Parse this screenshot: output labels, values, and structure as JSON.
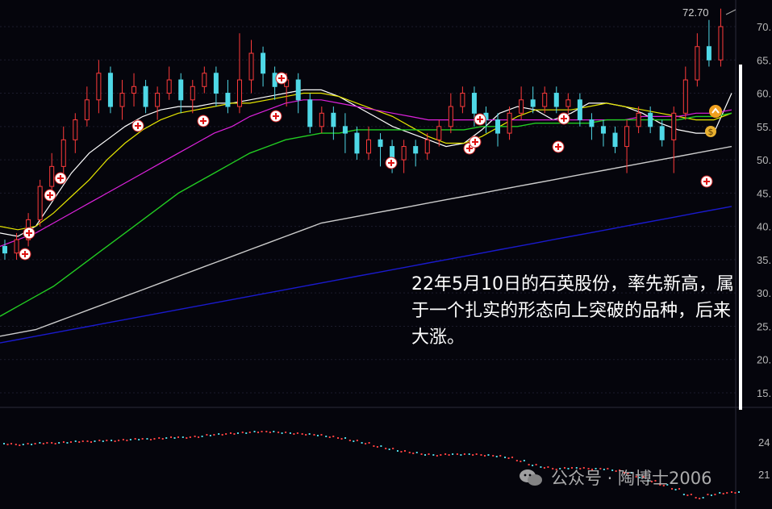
{
  "chart_data": {
    "type": "candlestick",
    "price_axis": {
      "ticks": [
        "70.",
        "65.",
        "60.",
        "55.",
        "50.",
        "45.",
        "40.",
        "35.",
        "30.",
        "25.",
        "20.",
        "15."
      ],
      "range": [
        12,
        75
      ]
    },
    "indicator_axis": {
      "ticks": [
        "24",
        "21"
      ]
    },
    "high_marker": "72.70",
    "annotation": "22年5月10日的石英股份，率先新高，属于一个扎实的形态向上突破的品种，后来大涨。",
    "moving_averages": [
      {
        "color": "#ffffff",
        "values": [
          39,
          38.5,
          40,
          44,
          48,
          51,
          53,
          55,
          56.5,
          57.5,
          58,
          58,
          58.5,
          58.5,
          59,
          59.5,
          60,
          60.5,
          60.5,
          59.5,
          58,
          56.5,
          55,
          54,
          53,
          52,
          52.5,
          54.5,
          57,
          58,
          57.5,
          56,
          57,
          58.5,
          58.5,
          58,
          57,
          55.5,
          54.5,
          54,
          54,
          60
        ]
      },
      {
        "color": "#e6e600",
        "values": [
          40,
          39.5,
          40,
          42,
          44.5,
          47,
          50,
          52.5,
          54.5,
          56,
          57,
          57.5,
          58,
          58.5,
          58.5,
          59,
          59.5,
          60,
          60,
          59.5,
          58.5,
          57.5,
          56.5,
          55,
          53.5,
          52.5,
          52.5,
          53.5,
          55,
          56.5,
          57.5,
          57.5,
          57.5,
          58,
          58.5,
          58,
          57.5,
          57,
          56.5,
          56,
          56,
          57
        ]
      },
      {
        "color": "#dd22dd",
        "values": [
          37,
          38,
          39,
          40.5,
          42,
          43.5,
          45,
          46.5,
          48,
          49.5,
          51,
          52.5,
          54,
          55,
          56.5,
          57.5,
          58.5,
          59,
          59,
          58.5,
          58,
          57.5,
          57,
          56.5,
          56,
          56,
          56,
          56,
          56,
          56,
          56,
          56,
          56,
          56,
          56,
          56,
          56.5,
          56.5,
          56.5,
          57,
          57,
          57.5
        ]
      },
      {
        "color": "#22cc22",
        "values": [
          26.5,
          28,
          29.5,
          31,
          33,
          35,
          37,
          39,
          41,
          43,
          45,
          46.5,
          48,
          49.5,
          51,
          52,
          53,
          53.5,
          54,
          54,
          54.5,
          54.5,
          54.5,
          54.5,
          54.5,
          54.5,
          54.5,
          55,
          55,
          55,
          55.5,
          55.5,
          55.5,
          55.5,
          56,
          56,
          56,
          56,
          56,
          56.5,
          56.5,
          57
        ]
      },
      {
        "color": "#cccccc",
        "values": [
          23.5,
          24,
          24.5,
          25.5,
          26.5,
          27.5,
          28.5,
          29.5,
          30.5,
          31.5,
          32.5,
          33.5,
          34.5,
          35.5,
          36.5,
          37.5,
          38.5,
          39.5,
          40.5,
          41,
          41.5,
          42,
          42.5,
          43,
          43.5,
          44,
          44.5,
          45,
          45.5,
          46,
          46.5,
          47,
          47.5,
          48,
          48.5,
          49,
          49.5,
          50,
          50.5,
          51,
          51.5,
          52
        ]
      },
      {
        "color": "#1a1acc",
        "values": [
          22.5,
          23,
          23.5,
          24,
          24.5,
          25,
          25.5,
          26,
          26.5,
          27,
          27.5,
          28,
          28.5,
          29,
          29.5,
          30,
          30.5,
          31,
          31.5,
          32,
          32.5,
          33,
          33.5,
          34,
          34.5,
          35,
          35.5,
          36,
          36.5,
          37,
          37.5,
          38,
          38.5,
          39,
          39.5,
          40,
          40.5,
          41,
          41.5,
          42,
          42.5,
          43
        ]
      }
    ],
    "candles": [
      [
        37,
        36,
        38,
        35
      ],
      [
        36,
        38,
        39,
        35
      ],
      [
        38,
        41,
        42,
        37
      ],
      [
        41,
        46,
        47,
        40
      ],
      [
        46,
        49,
        51,
        45
      ],
      [
        49,
        53,
        55,
        48
      ],
      [
        53,
        56,
        57,
        51
      ],
      [
        56,
        59,
        61,
        55
      ],
      [
        59,
        63,
        65,
        57
      ],
      [
        63,
        58,
        64,
        57
      ],
      [
        58,
        60,
        62,
        56
      ],
      [
        60,
        61,
        63,
        58
      ],
      [
        61,
        58,
        62,
        57
      ],
      [
        58,
        60,
        61,
        56
      ],
      [
        60,
        62,
        64,
        59
      ],
      [
        62,
        59,
        63,
        57
      ],
      [
        59,
        61,
        62,
        57
      ],
      [
        61,
        63,
        64,
        60
      ],
      [
        63,
        60,
        64,
        58
      ],
      [
        60,
        58,
        62,
        57
      ],
      [
        58,
        62,
        69,
        57
      ],
      [
        62,
        66,
        68,
        60
      ],
      [
        66,
        63,
        67,
        61
      ],
      [
        63,
        61,
        64,
        59
      ],
      [
        61,
        62,
        63,
        58
      ],
      [
        62,
        59,
        63,
        57
      ],
      [
        59,
        55,
        60,
        54
      ],
      [
        55,
        57,
        58,
        54
      ],
      [
        57,
        55,
        58,
        53
      ],
      [
        55,
        54,
        57,
        51
      ],
      [
        54,
        51,
        55,
        50
      ],
      [
        51,
        53,
        55,
        50
      ],
      [
        53,
        52,
        54,
        49
      ],
      [
        52,
        50,
        53,
        48
      ],
      [
        50,
        52,
        53,
        48
      ],
      [
        52,
        51,
        53,
        49
      ],
      [
        51,
        53,
        54,
        50
      ],
      [
        53,
        55,
        56,
        52
      ],
      [
        55,
        58,
        60,
        54
      ],
      [
        58,
        60,
        61,
        57
      ],
      [
        60,
        57,
        61,
        55
      ],
      [
        57,
        56,
        58,
        54
      ],
      [
        56,
        54,
        57,
        52
      ],
      [
        54,
        57,
        58,
        53
      ],
      [
        57,
        59,
        61,
        56
      ],
      [
        59,
        58,
        61,
        57
      ],
      [
        58,
        60,
        61,
        57
      ],
      [
        60,
        58,
        61,
        57
      ],
      [
        58,
        59,
        60,
        57
      ],
      [
        59,
        56,
        60,
        55
      ],
      [
        56,
        55,
        57,
        53
      ],
      [
        55,
        54,
        56,
        52
      ],
      [
        54,
        52,
        55,
        51
      ],
      [
        52,
        55,
        56,
        48
      ],
      [
        55,
        57,
        58,
        54
      ],
      [
        57,
        55,
        58,
        54
      ],
      [
        55,
        53,
        56,
        52
      ],
      [
        53,
        57,
        58,
        48
      ],
      [
        57,
        62,
        64,
        56
      ],
      [
        62,
        67,
        69,
        61
      ],
      [
        67,
        65,
        71,
        64
      ],
      [
        65,
        70,
        72.7,
        64
      ]
    ],
    "signal_markers": [
      "plus",
      "plus",
      "plus",
      "plus",
      "plus",
      "plus",
      "plus",
      "plus",
      "plus",
      "plus",
      "plus",
      "plus",
      "plus",
      "plus",
      "plus",
      "dollar-bag",
      "up-arrow"
    ]
  },
  "watermark": {
    "text": "公众号 · 陶博士2006",
    "icon": "wechat-icon"
  }
}
